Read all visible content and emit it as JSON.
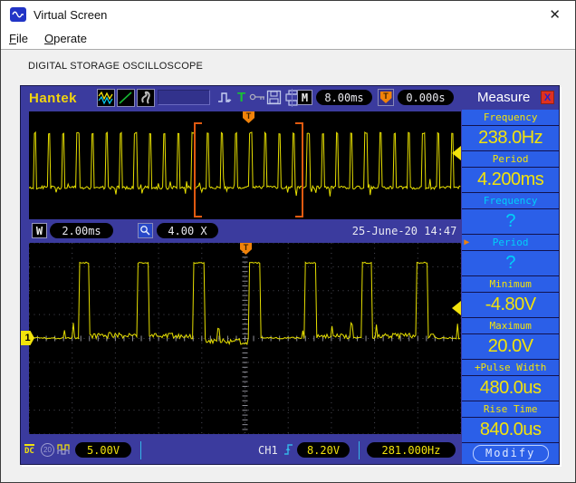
{
  "window": {
    "title": "Virtual Screen",
    "close_glyph": "✕"
  },
  "menu": {
    "file": {
      "accel": "F",
      "rest": "ile"
    },
    "operate": {
      "accel": "O",
      "rest": "perate"
    }
  },
  "heading": "DIGITAL STORAGE OSCILLOSCOPE",
  "toolbar": {
    "brand": "Hantek",
    "trigger_menu_glyph": "T",
    "m_label": "M",
    "timebase": "8.00ms",
    "trigger_glyph": "T",
    "trigger_time": "0.000s"
  },
  "window_bar": {
    "w_label": "W",
    "window_timebase": "2.00ms",
    "zoom_factor": "4.00 X",
    "datetime": "25-June-20 14:47"
  },
  "display": {
    "trigger_glyph": "T",
    "channel_badge": "1"
  },
  "bottom_bar": {
    "coupling": "DC",
    "bandwidth_badge": "20",
    "volts_per_div": "5.00V",
    "channel_label": "CH1",
    "trigger_level": "8.20V",
    "trigger_frequency": "281.000Hz"
  },
  "measure": {
    "title": "Measure",
    "close_glyph": "X",
    "selected_arrow": "▶",
    "items": [
      {
        "label": "Frequency",
        "value": "238.0Hz",
        "state": "measured",
        "selected": false
      },
      {
        "label": "Period",
        "value": "4.200ms",
        "state": "measured",
        "selected": false
      },
      {
        "label": "Frequency",
        "value": "?",
        "state": "pending",
        "selected": false
      },
      {
        "label": "Period",
        "value": "?",
        "state": "pending",
        "selected": true
      },
      {
        "label": "Minimum",
        "value": "-4.80V",
        "state": "measured",
        "selected": false
      },
      {
        "label": "Maximum",
        "value": "20.0V",
        "state": "measured",
        "selected": false
      },
      {
        "label": "+Pulse Width",
        "value": "480.0us",
        "state": "measured",
        "selected": false
      },
      {
        "label": "Rise Time",
        "value": "840.0us",
        "state": "measured",
        "selected": false
      }
    ],
    "modify_label": "Modify"
  },
  "waveform": {
    "overview_pulse_count": 30,
    "zoom_pulse_count": 7
  },
  "colors": {
    "accent_yellow": "#f2e30c",
    "accent_cyan": "#00d0f8",
    "frame_blue": "#3b3b9e",
    "panel_blue": "#2b5fe8",
    "trigger_orange": "#f0820a",
    "bracket_orange": "#e05a10"
  }
}
